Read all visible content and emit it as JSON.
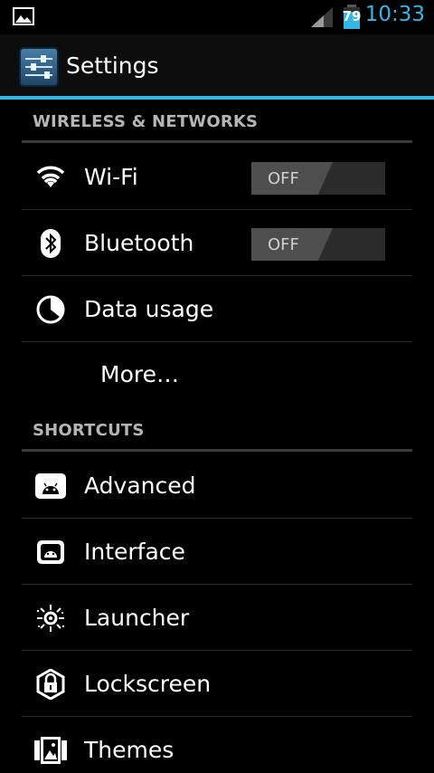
{
  "status_bar": {
    "battery_level": "79",
    "time": "10:33",
    "icons": [
      "gallery-icon",
      "signal-icon",
      "battery-icon"
    ],
    "time_color": "#33b5e5"
  },
  "action_bar": {
    "title": "Settings",
    "icon": "settings-sliders-icon",
    "accent_color": "#33b5e5"
  },
  "sections": [
    {
      "header": "WIRELESS & NETWORKS",
      "items": [
        {
          "label": "Wi-Fi",
          "icon": "wifi-icon",
          "toggle": "OFF"
        },
        {
          "label": "Bluetooth",
          "icon": "bluetooth-icon",
          "toggle": "OFF"
        },
        {
          "label": "Data usage",
          "icon": "data-usage-icon"
        },
        {
          "label": "More…"
        }
      ]
    },
    {
      "header": "SHORTCUTS",
      "items": [
        {
          "label": "Advanced",
          "icon": "android-advanced-icon"
        },
        {
          "label": "Interface",
          "icon": "android-interface-icon"
        },
        {
          "label": "Launcher",
          "icon": "launcher-icon"
        },
        {
          "label": "Lockscreen",
          "icon": "lockscreen-icon"
        },
        {
          "label": "Themes",
          "icon": "themes-icon"
        }
      ]
    }
  ]
}
